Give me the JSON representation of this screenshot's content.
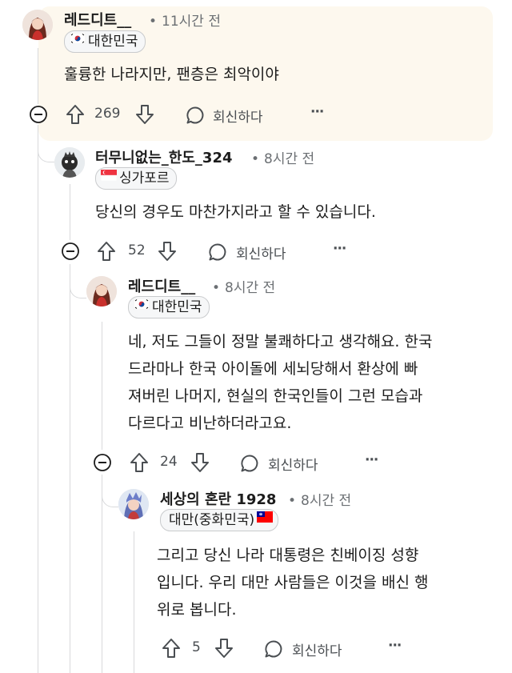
{
  "comments": [
    {
      "username": "레드디트__",
      "time": "11시간 전",
      "flair": "대한민국",
      "flair_flag": "korea",
      "body": [
        "훌륭한 나라지만, 팬층은 최악이야"
      ],
      "votes": "269",
      "reply_label": "회신하다",
      "more": "···",
      "highlighted": true
    },
    {
      "username": "터무니없는_한도_324",
      "time": "8시간 전",
      "flair": "싱가포르",
      "flair_flag": "singapore",
      "body": [
        "당신의 경우도 마찬가지라고 할 수 있습니다."
      ],
      "votes": "52",
      "reply_label": "회신하다",
      "more": "···"
    },
    {
      "username": "레드디트__",
      "time": "8시간 전",
      "flair": "대한민국",
      "flair_flag": "korea",
      "body": [
        "네, 저도 그들이 정말 불쾌하다고 생각해요. 한국",
        "드라마나 한국 아이돌에 세뇌당해서 환상에 빠",
        "져버린 나머지, 현실의 한국인들이 그런 모습과",
        "다르다고 비난하더라고요."
      ],
      "votes": "24",
      "reply_label": "회신하다",
      "more": "···"
    },
    {
      "username": "세상의 혼란 1928",
      "time": "8시간 전",
      "flair": "대만(중화민국)",
      "flair_flag": "taiwan",
      "body": [
        "그리고 당신 나라 대통령은 친베이징 성향",
        "입니다. 우리 대만 사람들은 이것을 배신 행",
        "위로 봅니다."
      ],
      "votes": "5",
      "reply_label": "회신하다",
      "more": "···"
    }
  ],
  "colors": {
    "highlight_bg": "#fdf8ee",
    "thread_line": "#d9dadc",
    "meta_gray": "#6b6f73",
    "text": "#1c1c1c"
  }
}
